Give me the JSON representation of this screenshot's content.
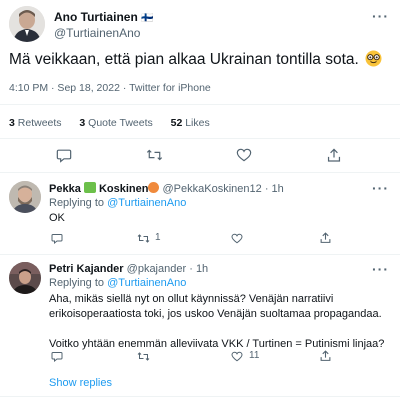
{
  "main_tweet": {
    "author_name": "Ano Turtiainen",
    "flag": "🇫🇮",
    "handle": "@TurtiainenAno",
    "text": "Mä veikkaan, että pian alkaa Ukrainan tontilla sota.",
    "emoji": "🤓",
    "time": "4:10 PM · Sep 18, 2022",
    "separator": " · ",
    "source": "Twitter for iPhone",
    "stats": {
      "retweets_count": "3",
      "retweets_label": "Retweets",
      "quotes_count": "3",
      "quotes_label": "Quote Tweets",
      "likes_count": "52",
      "likes_label": "Likes"
    }
  },
  "replies": [
    {
      "author_name_1": "Pekka",
      "author_name_2": "Koskinen",
      "handle": "@PekkaKoskinen12",
      "dot": "·",
      "time": "1h",
      "replying_label": "Replying to",
      "replying_to": "@TurtiainenAno",
      "text": "OK",
      "retweet_count": "1"
    },
    {
      "author_name": "Petri Kajander",
      "handle": "@pkajander",
      "dot": "·",
      "time": "1h",
      "replying_label": "Replying to",
      "replying_to": "@TurtiainenAno",
      "text_line1": "Aha, mikäs siellä nyt on ollut käynnissä? Venäjän narratiivi",
      "text_line2": "erikoisoperaatiosta toki, jos uskoo Venäjän suoltamaa propagandaa.",
      "text_line3": "Voitko yhtään enemmän alleviivata VKK / Turtinen = Putinismi linjaa?",
      "like_count": "11"
    }
  ],
  "show_replies": "Show replies",
  "more_icon": "···",
  "colors": {
    "link": "#1d9bf0",
    "muted": "#536471",
    "divider": "#eff3f4"
  }
}
